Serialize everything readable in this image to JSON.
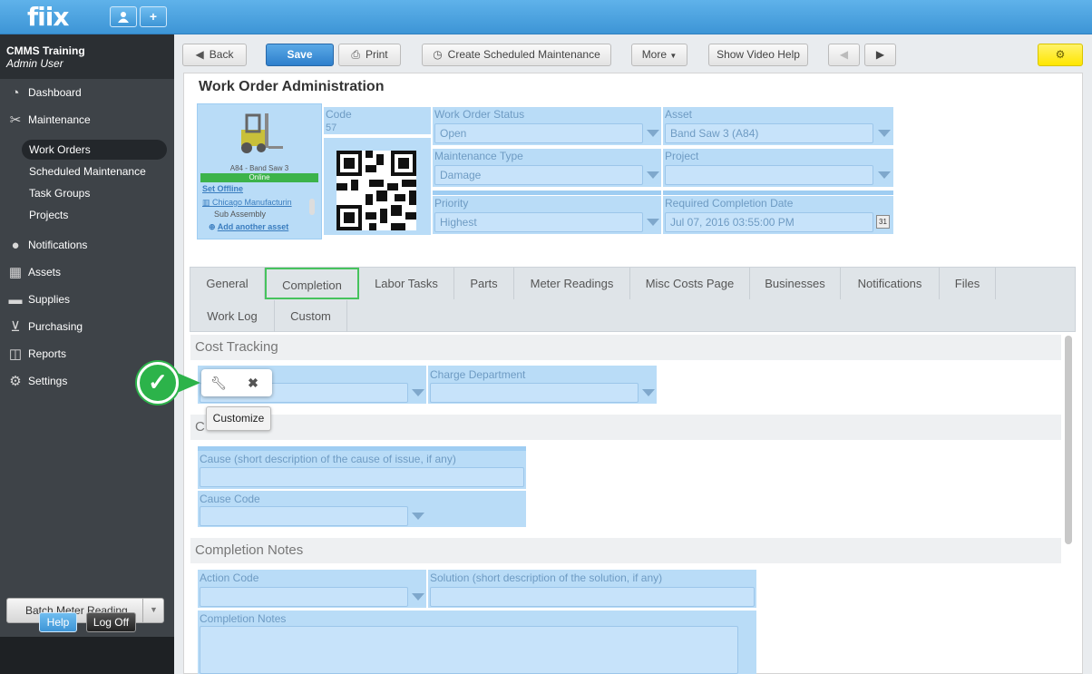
{
  "app": {
    "logo": "fiix",
    "user_btn": "user-icon",
    "add_btn": "+"
  },
  "sidebar": {
    "company": "CMMS Training",
    "role": "Admin User",
    "items": [
      {
        "label": "Dashboard",
        "icon": "dashboard-icon"
      },
      {
        "label": "Maintenance",
        "icon": "tools-icon"
      },
      {
        "label": "Notifications",
        "icon": "chat-icon"
      },
      {
        "label": "Assets",
        "icon": "boxes-icon"
      },
      {
        "label": "Supplies",
        "icon": "truck-icon"
      },
      {
        "label": "Purchasing",
        "icon": "cart-icon"
      },
      {
        "label": "Reports",
        "icon": "chart-icon"
      },
      {
        "label": "Settings",
        "icon": "gear-icon"
      }
    ],
    "sub": [
      "Work Orders",
      "Scheduled Maintenance",
      "Task Groups",
      "Projects"
    ],
    "batch": "Batch Meter Reading",
    "help": "Help",
    "logoff": "Log Off"
  },
  "toolbar": {
    "back": "Back",
    "save": "Save",
    "print": "Print",
    "csm": "Create Scheduled Maintenance",
    "more": "More",
    "video": "Show Video Help"
  },
  "page": {
    "title": "Work Order Administration"
  },
  "asset_card": {
    "name": "A84 - Band Saw 3",
    "status": "Online",
    "set_offline": "Set Offline",
    "location": "Chicago Manufacturin",
    "sub": "Sub Assembly",
    "add": "Add another asset"
  },
  "fields": {
    "code_label": "Code",
    "code_value": "57",
    "status_label": "Work Order Status",
    "status_value": "Open",
    "asset_label": "Asset",
    "asset_value": "Band Saw 3 (A84)",
    "mtype_label": "Maintenance Type",
    "mtype_value": "Damage",
    "project_label": "Project",
    "project_value": "",
    "priority_label": "Priority",
    "priority_value": "Highest",
    "rcd_label": "Required Completion Date",
    "rcd_value": "Jul 07, 2016 03:55:00 PM",
    "cal": "31"
  },
  "tabs": [
    "General",
    "Completion",
    "Labor Tasks",
    "Parts",
    "Meter Readings",
    "Misc Costs Page",
    "Businesses",
    "Notifications",
    "Files",
    "Work Log",
    "Custom"
  ],
  "sections": {
    "cost": "Cost Tracking",
    "charge_dept": "Charge Department",
    "c_prefix": "C",
    "cause_label": "Cause (short description of the cause of issue, if any)",
    "cause_code": "Cause Code",
    "notes_title": "Completion Notes",
    "action_code": "Action Code",
    "solution": "Solution (short description of the solution, if any)",
    "notes_label": "Completion Notes"
  },
  "overlay": {
    "tooltip": "Customize"
  },
  "colors": {
    "accent": "#3d95d6",
    "success": "#2cb34a",
    "highlight": "#b9dcf7"
  }
}
